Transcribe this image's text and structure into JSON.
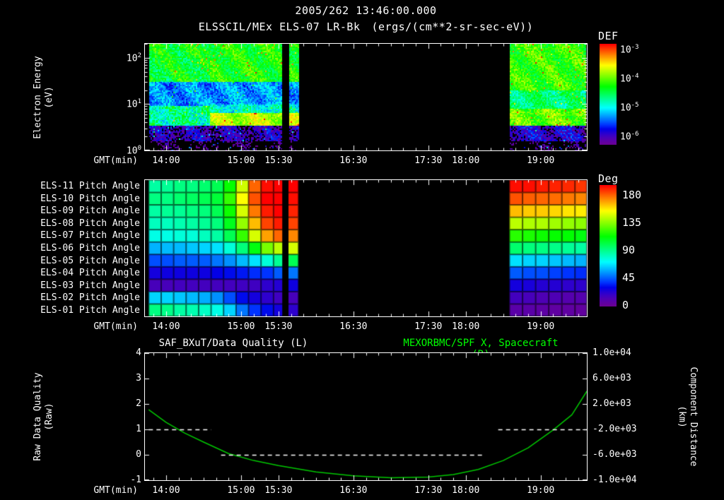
{
  "header": {
    "timestamp": "2005/262 13:46:00.000",
    "title": "ELSSCIL/MEx ELS-07 LR-Bk",
    "units": "(ergs/(cm**2-sr-sec-eV))"
  },
  "colors": {
    "background": "#000000",
    "text": "#ffffff",
    "frame": "#ffffff",
    "title_right_green": "#00ff00",
    "curve_green": "#00c800"
  },
  "time_axis": {
    "label": "GMT(min)",
    "start": "13:43",
    "end": "19:37",
    "major_ticks": [
      "14:00",
      "15:00",
      "15:30",
      "16:30",
      "17:30",
      "18:00",
      "19:00"
    ],
    "minor_tick_minutes": 10
  },
  "chart_data": [
    {
      "id": "electron-energy-spectrogram",
      "type": "heatmap",
      "ylabel_lines": [
        "Electron Energy",
        "(eV)"
      ],
      "yscale": "log",
      "ylim": [
        1,
        200
      ],
      "y_ticks": [
        {
          "label": "10^2",
          "value": 100
        },
        {
          "label": "10^1",
          "value": 10
        },
        {
          "label": "10^0",
          "value": 1
        }
      ],
      "colorbar": {
        "label": "DEF",
        "log_range": [
          -6.3,
          -2.8
        ],
        "ticks": [
          {
            "label": "10^-3",
            "value": -3
          },
          {
            "label": "10^-4",
            "value": -4
          },
          {
            "label": "10^-5",
            "value": -5
          },
          {
            "label": "10^-6",
            "value": -6
          }
        ]
      },
      "segments": [
        {
          "t": [
            "13:46",
            "14:35"
          ],
          "bands": [
            {
              "e": [
                30,
                200
              ],
              "logf": -4.35,
              "noise": 0.35
            },
            {
              "e": [
                9,
                30
              ],
              "logf": -5.35,
              "noise": 0.3
            },
            {
              "e": [
                3.5,
                9
              ],
              "logf": -4.7,
              "noise": 0.45
            },
            {
              "e": [
                1.6,
                3.5
              ],
              "logf": -6.05,
              "noise": 0.4
            },
            {
              "e": [
                1,
                1.6
              ],
              "logf": -6.45,
              "noise": 0.35
            }
          ]
        },
        {
          "t": [
            "14:35",
            "15:33"
          ],
          "bands": [
            {
              "e": [
                30,
                200
              ],
              "logf": -4.25,
              "noise": 0.3
            },
            {
              "e": [
                10,
                30
              ],
              "logf": -5.3,
              "noise": 0.3
            },
            {
              "e": [
                6.5,
                10
              ],
              "logf": -4.9,
              "noise": 0.35
            },
            {
              "e": [
                3.5,
                6.5
              ],
              "logf": -3.75,
              "noise": 0.25
            },
            {
              "e": [
                1.6,
                3.5
              ],
              "logf": -6.05,
              "noise": 0.4
            },
            {
              "e": [
                1,
                1.6
              ],
              "logf": -6.45,
              "noise": 0.35
            }
          ]
        },
        {
          "t": [
            "15:38",
            "15:47"
          ],
          "bands": [
            {
              "e": [
                30,
                200
              ],
              "logf": -4.25,
              "noise": 0.3
            },
            {
              "e": [
                10,
                30
              ],
              "logf": -5.3,
              "noise": 0.3
            },
            {
              "e": [
                6.5,
                10
              ],
              "logf": -4.9,
              "noise": 0.35
            },
            {
              "e": [
                3.5,
                6.5
              ],
              "logf": -3.75,
              "noise": 0.25
            },
            {
              "e": [
                1.6,
                3.5
              ],
              "logf": -6.05,
              "noise": 0.4
            },
            {
              "e": [
                1,
                1.6
              ],
              "logf": -6.45,
              "noise": 0.35
            }
          ]
        },
        {
          "t": [
            "18:35",
            "19:37"
          ],
          "bands": [
            {
              "e": [
                20,
                200
              ],
              "logf": -4.15,
              "noise": 0.3
            },
            {
              "e": [
                8,
                20
              ],
              "logf": -4.6,
              "noise": 0.3
            },
            {
              "e": [
                3.5,
                8
              ],
              "logf": -4.0,
              "noise": 0.3
            },
            {
              "e": [
                1.6,
                3.5
              ],
              "logf": -5.95,
              "noise": 0.4
            },
            {
              "e": [
                1,
                1.6
              ],
              "logf": -6.45,
              "noise": 0.35
            }
          ]
        }
      ]
    },
    {
      "id": "pitch-angle-heatmap",
      "type": "heatmap",
      "rows": [
        "ELS-11 Pitch Angle",
        "ELS-10 Pitch Angle",
        "ELS-09 Pitch Angle",
        "ELS-08 Pitch Angle",
        "ELS-07 Pitch Angle",
        "ELS-06 Pitch Angle",
        "ELS-05 Pitch Angle",
        "ELS-04 Pitch Angle",
        "ELS-03 Pitch Angle",
        "ELS-02 Pitch Angle",
        "ELS-01 Pitch Angle"
      ],
      "colorbar": {
        "label": "Deg",
        "range": [
          0,
          180
        ],
        "ticks": [
          180,
          135,
          90,
          45,
          0
        ]
      },
      "stripes": [
        [
          "15:33",
          "15:38"
        ]
      ],
      "blocks": [
        {
          "t_start": "13:46",
          "col_minutes": 10,
          "values": [
            [
              80,
              82,
              85,
              85,
              88,
              92,
              105,
              135,
              165,
              178,
              180,
              180
            ],
            [
              85,
              85,
              88,
              90,
              92,
              96,
              112,
              142,
              168,
              180,
              180,
              178
            ],
            [
              80,
              82,
              82,
              85,
              86,
              92,
              106,
              136,
              162,
              176,
              180,
              175
            ],
            [
              76,
              76,
              78,
              80,
              82,
              86,
              100,
              126,
              152,
              170,
              176,
              170
            ],
            [
              70,
              70,
              72,
              72,
              76,
              80,
              92,
              112,
              136,
              156,
              165,
              160
            ],
            [
              55,
              56,
              56,
              58,
              60,
              62,
              72,
              86,
              102,
              122,
              132,
              136
            ],
            [
              40,
              40,
              42,
              42,
              42,
              46,
              50,
              56,
              62,
              72,
              82,
              92
            ],
            [
              25,
              26,
              26,
              26,
              26,
              28,
              30,
              32,
              35,
              36,
              42,
              46
            ],
            [
              14,
              14,
              15,
              15,
              15,
              15,
              15,
              16,
              16,
              20,
              22,
              26
            ],
            [
              60,
              60,
              58,
              56,
              54,
              50,
              40,
              30,
              25,
              20,
              16,
              14
            ],
            [
              85,
              84,
              80,
              78,
              75,
              70,
              60,
              46,
              36,
              30,
              25,
              20
            ]
          ]
        },
        {
          "t_start": "18:35",
          "col_minutes": 10.5,
          "values": [
            [
              178,
              178,
              176,
              175,
              174,
              172
            ],
            [
              168,
              166,
              165,
              164,
              162,
              160
            ],
            [
              152,
              150,
              150,
              148,
              146,
              145
            ],
            [
              132,
              130,
              130,
              128,
              126,
              125
            ],
            [
              110,
              108,
              106,
              105,
              104,
              102
            ],
            [
              88,
              86,
              85,
              84,
              82,
              80
            ],
            [
              62,
              60,
              60,
              58,
              56,
              55
            ],
            [
              42,
              40,
              40,
              38,
              36,
              35
            ],
            [
              25,
              24,
              22,
              22,
              20,
              20
            ],
            [
              15,
              14,
              12,
              12,
              10,
              10
            ],
            [
              8,
              8,
              7,
              6,
              6,
              5
            ]
          ]
        }
      ]
    },
    {
      "id": "quality-and-distance",
      "type": "line",
      "title_left": "SAF_BXuT/Data Quality (L)",
      "title_right": "MEXORBMC/SPF X, Spacecraft (R)",
      "left_axis": {
        "label_lines": [
          "Raw Data Quality",
          "(Raw)"
        ],
        "range": [
          -1,
          4
        ],
        "ticks": [
          4,
          3,
          2,
          1,
          0,
          -1
        ]
      },
      "right_axis": {
        "label_lines": [
          "Component Distance",
          "(km)"
        ],
        "range": [
          -10000,
          10000
        ],
        "ticks": [
          "1.0e+04",
          "6.0e+03",
          "2.0e+03",
          "-2.0e+03",
          "-6.0e+03",
          "-1.0e+04"
        ]
      },
      "series": [
        {
          "name": "MEXORBMC/SPF X, Spacecraft",
          "axis": "right",
          "color": "#00c800",
          "style": "solid",
          "points": [
            [
              "13:46",
              1100
            ],
            [
              "14:00",
              -900
            ],
            [
              "14:15",
              -2600
            ],
            [
              "14:30",
              -4000
            ],
            [
              "14:50",
              -5800
            ],
            [
              "15:10",
              -6900
            ],
            [
              "15:30",
              -7700
            ],
            [
              "16:00",
              -8700
            ],
            [
              "16:30",
              -9300
            ],
            [
              "17:00",
              -9600
            ],
            [
              "17:30",
              -9500
            ],
            [
              "17:50",
              -9100
            ],
            [
              "18:10",
              -8300
            ],
            [
              "18:30",
              -6900
            ],
            [
              "18:50",
              -4900
            ],
            [
              "19:10",
              -2100
            ],
            [
              "19:25",
              300
            ],
            [
              "19:37",
              4000
            ]
          ]
        },
        {
          "name": "SAF_BXuT/Data Quality",
          "axis": "left",
          "color": "#ffffff",
          "style": "dashed",
          "dash": [
            6,
            5
          ],
          "segments": [
            {
              "value": 1,
              "t_start": "13:46",
              "t_end": "14:36"
            },
            {
              "value": 0,
              "t_start": "14:44",
              "t_end": "18:14"
            },
            {
              "value": 1,
              "t_start": "18:26",
              "t_end": "19:37"
            }
          ]
        }
      ]
    }
  ]
}
